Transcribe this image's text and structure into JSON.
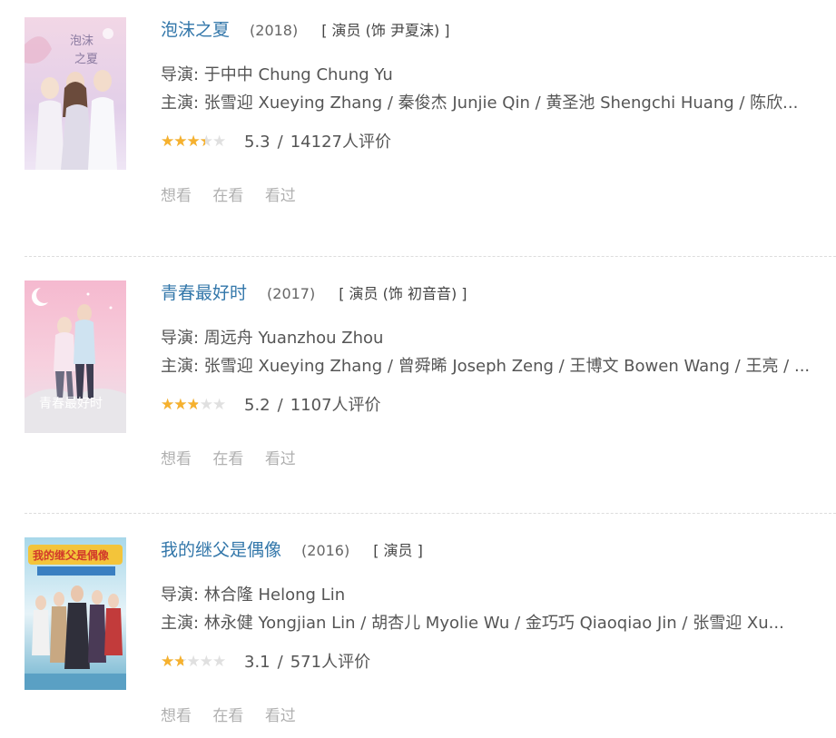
{
  "items": [
    {
      "title": "泡沫之夏",
      "year": "(2018)",
      "role": "[ 演员 (饰 尹夏沫) ]",
      "director": "导演: 于中中 Chung Chung Yu",
      "cast": "主演: 张雪迎 Xueying Zhang / 秦俊杰 Junjie Qin / 黄圣池 Shengchi Huang / 陈欣...",
      "stars": 3,
      "score": "5.3",
      "sep": "/",
      "votes": "14127人评价",
      "actions": [
        "想看",
        "在看",
        "看过"
      ],
      "poster_colors": [
        "#f2d7e6",
        "#d9c4e4",
        "#efe6f5"
      ]
    },
    {
      "title": "青春最好时",
      "year": "(2017)",
      "role": "[ 演员 (饰 初音音) ]",
      "director": "导演: 周远舟 Yuanzhou Zhou",
      "cast": "主演: 张雪迎 Xueying Zhang / 曾舜晞 Joseph Zeng / 王博文 Bowen Wang / 王亮 / ...",
      "stars": 2.5,
      "score": "5.2",
      "sep": "/",
      "votes": "1107人评价",
      "actions": [
        "想看",
        "在看",
        "看过"
      ],
      "poster_colors": [
        "#f5b9cf",
        "#f7d0de",
        "#e9e3ec"
      ]
    },
    {
      "title": "我的继父是偶像",
      "year": "(2016)",
      "role": "[ 演员 ]",
      "director": "导演: 林合隆 Helong Lin",
      "cast": "主演: 林永健 Yongjian Lin / 胡杏儿 Myolie Wu / 金巧巧 Qiaoqiao Jin / 张雪迎 Xu...",
      "stars": 1.5,
      "score": "3.1",
      "sep": "/",
      "votes": "571人评价",
      "actions": [
        "想看",
        "在看",
        "看过"
      ],
      "poster_colors": [
        "#a8d8ea",
        "#e6f3f8",
        "#6fb3cf"
      ]
    }
  ]
}
